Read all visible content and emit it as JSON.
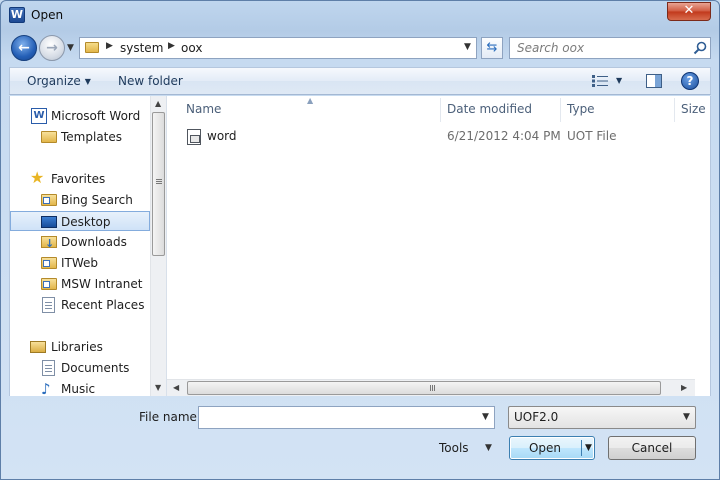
{
  "window": {
    "title": "Open",
    "app_icon_letter": "W"
  },
  "address": {
    "crumbs": [
      "system",
      "oox"
    ]
  },
  "search": {
    "placeholder": "Search oox"
  },
  "toolbar": {
    "organize_label": "Organize",
    "new_folder_label": "New folder",
    "help_glyph": "?"
  },
  "nav_pane": {
    "items": [
      {
        "label": "Microsoft Word",
        "icon": "word-icon",
        "selected": false
      },
      {
        "label": "Templates",
        "icon": "folder-icon",
        "selected": false
      },
      {
        "label": "Favorites",
        "icon": "star-icon",
        "selected": false
      },
      {
        "label": "Bing Search",
        "icon": "link-icon",
        "selected": false
      },
      {
        "label": "Desktop",
        "icon": "desktop-icon",
        "selected": true
      },
      {
        "label": "Downloads",
        "icon": "downloads-icon",
        "selected": false
      },
      {
        "label": "ITWeb",
        "icon": "link-icon",
        "selected": false
      },
      {
        "label": "MSW Intranet",
        "icon": "link-icon",
        "selected": false
      },
      {
        "label": "Recent Places",
        "icon": "recent-places-icon",
        "selected": false
      },
      {
        "label": "Libraries",
        "icon": "libraries-icon",
        "selected": false
      },
      {
        "label": "Documents",
        "icon": "documents-icon",
        "selected": false
      },
      {
        "label": "Music",
        "icon": "music-icon",
        "selected": false
      }
    ]
  },
  "file_list": {
    "columns": [
      "Name",
      "Date modified",
      "Type",
      "Size"
    ],
    "rows": [
      {
        "name": "word",
        "date_modified": "6/21/2012 4:04 PM",
        "type": "UOT File",
        "size": ""
      }
    ]
  },
  "bottom": {
    "file_name_label": "File name:",
    "file_name_value": "",
    "file_type_filter": "UOF2.0",
    "tools_label": "Tools",
    "open_label": "Open",
    "cancel_label": "Cancel"
  },
  "colors": {
    "accent": "#3c7fb1",
    "selection": "#cfe2f7"
  }
}
